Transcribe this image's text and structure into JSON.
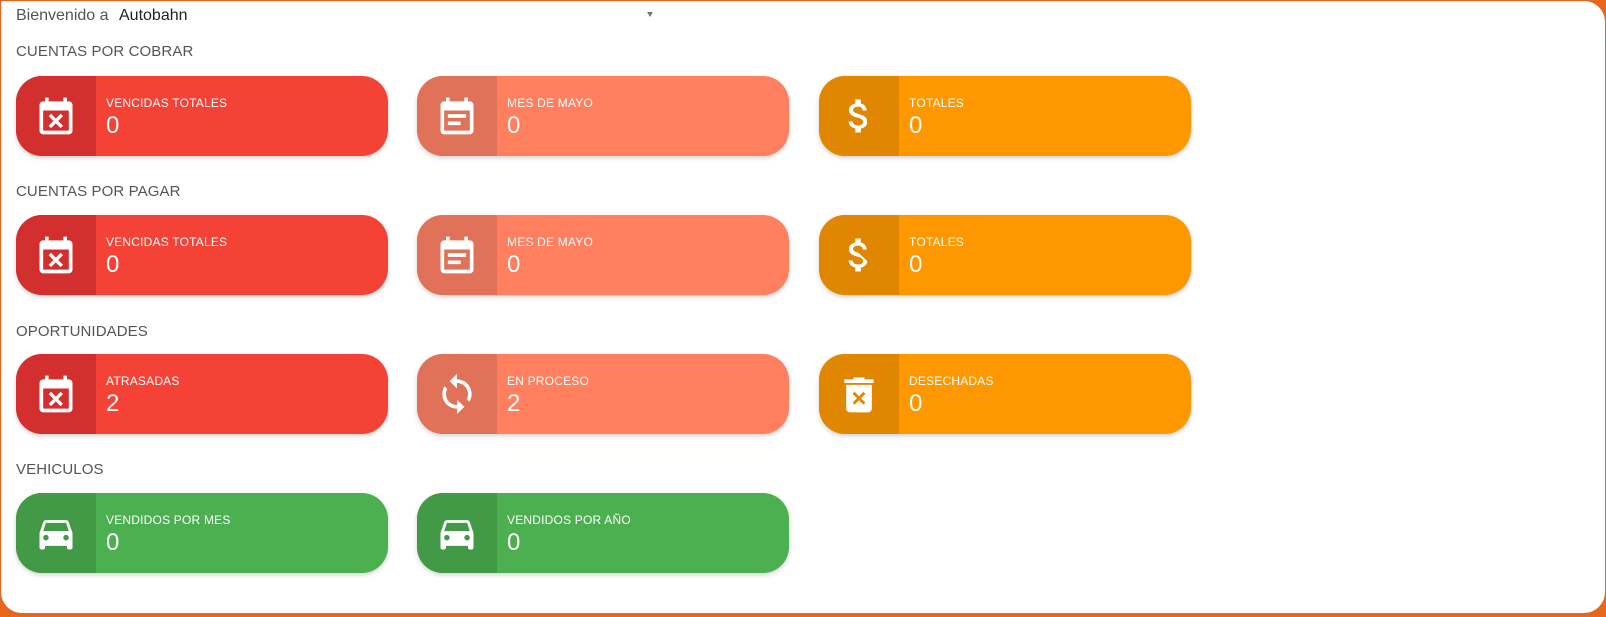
{
  "header": {
    "welcome_label": "Bienvenido a",
    "company_selected": "Autobahn"
  },
  "colors": {
    "red": "#f44336",
    "salmon": "#ff7f5f",
    "orange": "#ff9800",
    "green": "#4caf50",
    "frame_accent": "#e8651e"
  },
  "sections": {
    "cobrar": {
      "title": "CUENTAS POR COBRAR",
      "cards": [
        {
          "label": "VENCIDAS TOTALES",
          "value": "0",
          "icon": "calendar-x-icon"
        },
        {
          "label": "MES DE MAYO",
          "value": "0",
          "icon": "calendar-note-icon"
        },
        {
          "label": "TOTALES",
          "value": "0",
          "icon": "dollar-icon"
        }
      ]
    },
    "pagar": {
      "title": "CUENTAS POR PAGAR",
      "cards": [
        {
          "label": "VENCIDAS TOTALES",
          "value": "0",
          "icon": "calendar-x-icon"
        },
        {
          "label": "MES DE MAYO",
          "value": "0",
          "icon": "calendar-note-icon"
        },
        {
          "label": "TOTALES",
          "value": "0",
          "icon": "dollar-icon"
        }
      ]
    },
    "oportunidades": {
      "title": "OPORTUNIDADES",
      "cards": [
        {
          "label": "ATRASADAS",
          "value": "2",
          "icon": "calendar-x-icon"
        },
        {
          "label": "EN PROCESO",
          "value": "2",
          "icon": "refresh-icon"
        },
        {
          "label": "DESECHADAS",
          "value": "0",
          "icon": "trash-x-icon"
        }
      ]
    },
    "vehiculos": {
      "title": "VEHICULOS",
      "cards": [
        {
          "label": "VENDIDOS POR MES",
          "value": "0",
          "icon": "car-icon"
        },
        {
          "label": "VENDIDOS POR AÑO",
          "value": "0",
          "icon": "car-icon"
        }
      ]
    }
  }
}
